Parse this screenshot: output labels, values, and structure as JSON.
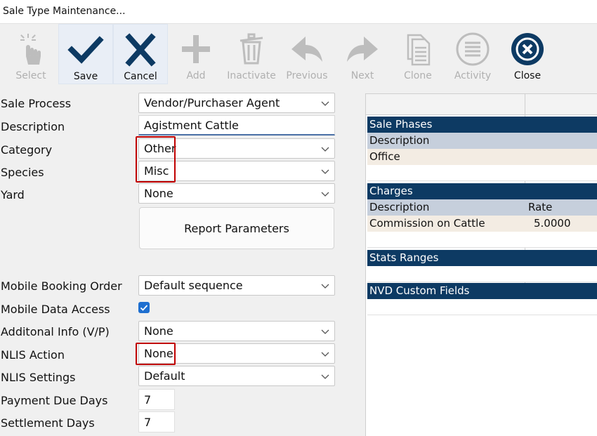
{
  "window": {
    "title": "Sale Type Maintenance..."
  },
  "toolbar": {
    "select": "Select",
    "save": "Save",
    "cancel": "Cancel",
    "add": "Add",
    "inactivate": "Inactivate",
    "previous": "Previous",
    "next": "Next",
    "clone": "Clone",
    "activity": "Activity",
    "close": "Close"
  },
  "form": {
    "sale_process_label": "Sale Process",
    "sale_process": "Vendor/Purchaser Agent",
    "description_label": "Description",
    "description": "Agistment Cattle",
    "category_label": "Category",
    "category": "Other",
    "species_label": "Species",
    "species": "Misc",
    "yard_label": "Yard",
    "yard": "None",
    "report_parameters": "Report Parameters",
    "mobile_booking_order_label": "Mobile Booking Order",
    "mobile_booking_order": "Default sequence",
    "mobile_data_access_label": "Mobile Data Access",
    "mobile_data_access_checked": true,
    "additional_info_label": "Additonal Info (V/P)",
    "additional_info": "None",
    "nlis_action_label": "NLIS Action",
    "nlis_action": "None",
    "nlis_settings_label": "NLIS Settings",
    "nlis_settings": "Default",
    "payment_due_days_label": "Payment Due Days",
    "payment_due_days": "7",
    "settlement_days_label": "Settlement Days",
    "settlement_days": "7"
  },
  "grid": {
    "sale_phases": {
      "title": "Sale Phases",
      "col1": "Description",
      "row1": "Office"
    },
    "charges": {
      "title": "Charges",
      "col1": "Description",
      "col2": "Rate",
      "row1_desc": "Commission  on Cattle",
      "row1_rate": "5.0000"
    },
    "stats_ranges": {
      "title": "Stats Ranges"
    },
    "nvd_custom_fields": {
      "title": "NVD Custom Fields"
    }
  },
  "colors": {
    "section_header": "#0d3a63",
    "sub_header": "#c6cfdc",
    "data_row": "#f3ece3",
    "highlight": "#c00000",
    "accent": "#0d3a63"
  }
}
